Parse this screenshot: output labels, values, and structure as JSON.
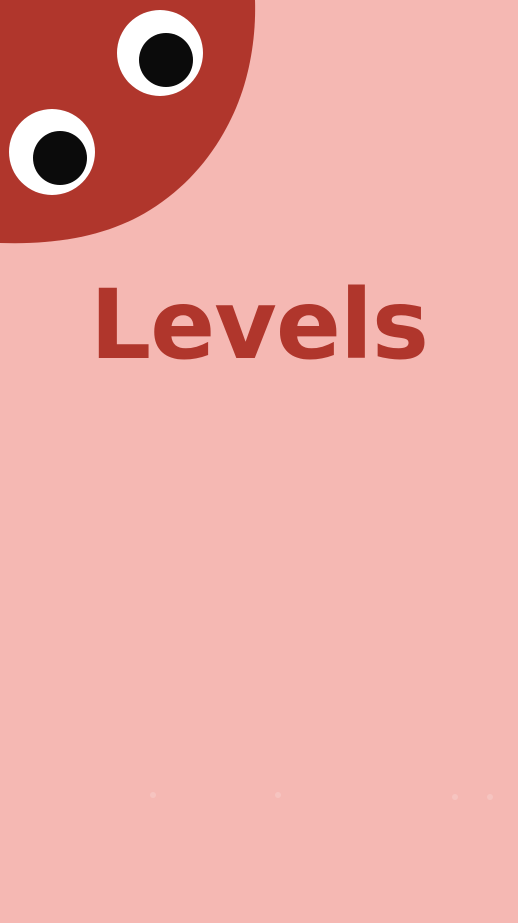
{
  "screen": {
    "title": "Levels"
  },
  "colors": {
    "background": "#f5b8b3",
    "accent": "#b0362c",
    "eye_white": "#ffffff",
    "pupil": "#0b0b0b"
  },
  "icons": {
    "mascot": "red-blob-with-googly-eyes"
  }
}
